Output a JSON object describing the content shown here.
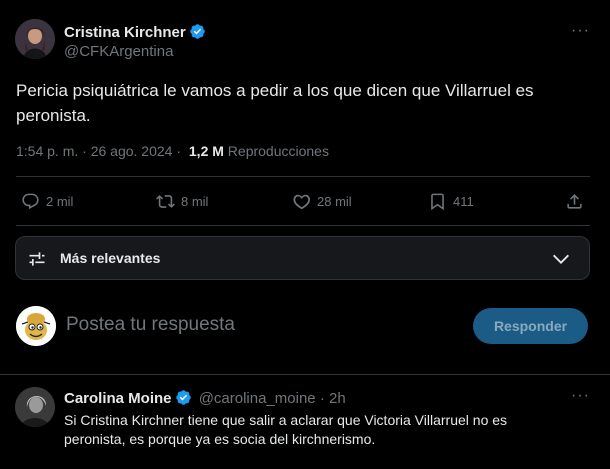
{
  "tweet": {
    "author_name": "Cristina Kirchner",
    "author_handle": "@CFKArgentina",
    "text_line1": "Pericia psiquiátrica le vamos a pedir a los que dicen que Villarruel es",
    "text_line2": "peronista.",
    "timestamp": "1:54 p. m. · 26 ago. 2024 ·",
    "views_count": "1,2 M",
    "views_label": "Reproducciones",
    "more": "···"
  },
  "actions": {
    "replies": "2 mil",
    "retweets": "8 mil",
    "likes": "28 mil",
    "bookmarks": "411"
  },
  "sort": {
    "label": "Más relevantes"
  },
  "compose": {
    "placeholder": "Postea tu respuesta",
    "button": "Responder"
  },
  "reply": {
    "author_name": "Carolina Moine",
    "author_handle": "@carolina_moine",
    "time": "· 2h",
    "text_line1": "Si Cristina Kirchner tiene que salir a aclarar que Victoria Villarruel no es",
    "text_line2": "peronista, es porque ya es socia del kirchnerismo.",
    "more": "···"
  },
  "colors": {
    "background": "#000000",
    "text": "#e7e9ea",
    "muted": "#71767b",
    "accent": "#1d9bf0",
    "button_bg": "#1a5c86",
    "separator": "#2f3336"
  }
}
